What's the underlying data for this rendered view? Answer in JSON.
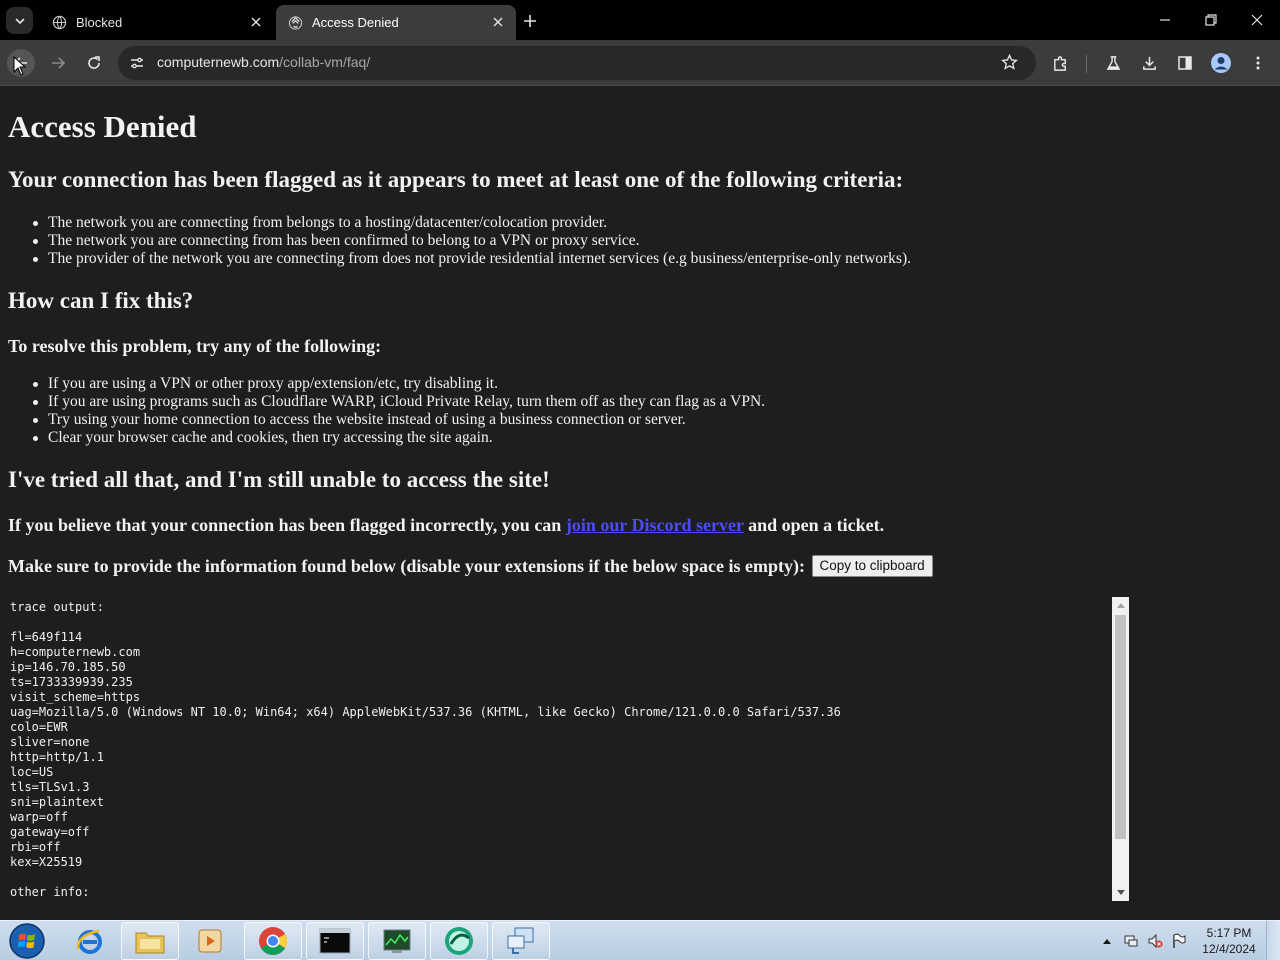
{
  "browser": {
    "tabs": [
      {
        "title": "Blocked",
        "icon": "globe-icon"
      },
      {
        "title": "Access Denied",
        "icon": "cloudflare-icon",
        "active": true
      }
    ],
    "url_host": "computernewb.com",
    "url_path": "/collab-vm/faq/"
  },
  "page": {
    "title": "Access Denied",
    "criteria_heading": "Your connection has been flagged as it appears to meet at least one of the following criteria:",
    "criteria": [
      "The network you are connecting from belongs to a hosting/datacenter/colocation provider.",
      "The network you are connecting from has been confirmed to belong to a VPN or proxy service.",
      "The provider of the network you are connecting from does not provide residential internet services (e.g business/enterprise-only networks)."
    ],
    "fix_heading": "How can I fix this?",
    "resolve_heading": "To resolve this problem, try any of the following:",
    "fixes": [
      "If you are using a VPN or other proxy app/extension/etc, try disabling it.",
      "If you are using programs such as Cloudflare WARP, iCloud Private Relay, turn them off as they can flag as a VPN.",
      "Try using your home connection to access the website instead of using a business connection or server.",
      "Clear your browser cache and cookies, then try accessing the site again."
    ],
    "still_heading": "I've tried all that, and I'm still unable to access the site!",
    "incorrect_prefix": "If you believe that your connection has been flagged incorrectly, you can",
    "incorrect_link": "join our Discord server",
    "incorrect_suffix": "and open a ticket.",
    "provide_info": "Make sure to provide the information found below (disable your extensions if the below space is empty):",
    "copy_button": "Copy to clipboard",
    "trace_output": "trace output:\n\nfl=649f114\nh=computernewb.com\nip=146.70.185.50\nts=1733339939.235\nvisit_scheme=https\nuag=Mozilla/5.0 (Windows NT 10.0; Win64; x64) AppleWebKit/537.36 (KHTML, like Gecko) Chrome/121.0.0.0 Safari/537.36\ncolo=EWR\nsliver=none\nhttp=http/1.1\nloc=US\ntls=TLSv1.3\nsni=plaintext\nwarp=off\ngateway=off\nrbi=off\nkex=X25519\n\nother info:"
  },
  "taskbar": {
    "apps": [
      "internet-explorer",
      "file-explorer",
      "media-player",
      "chrome",
      "command-prompt",
      "task-manager",
      "app-globe",
      "remote-desktop"
    ],
    "time": "5:17 PM",
    "date": "12/4/2024"
  },
  "colors": {
    "page_bg": "#1e1e1e",
    "toolbar_bg": "#3c3c3c",
    "link": "#4b4bff"
  }
}
